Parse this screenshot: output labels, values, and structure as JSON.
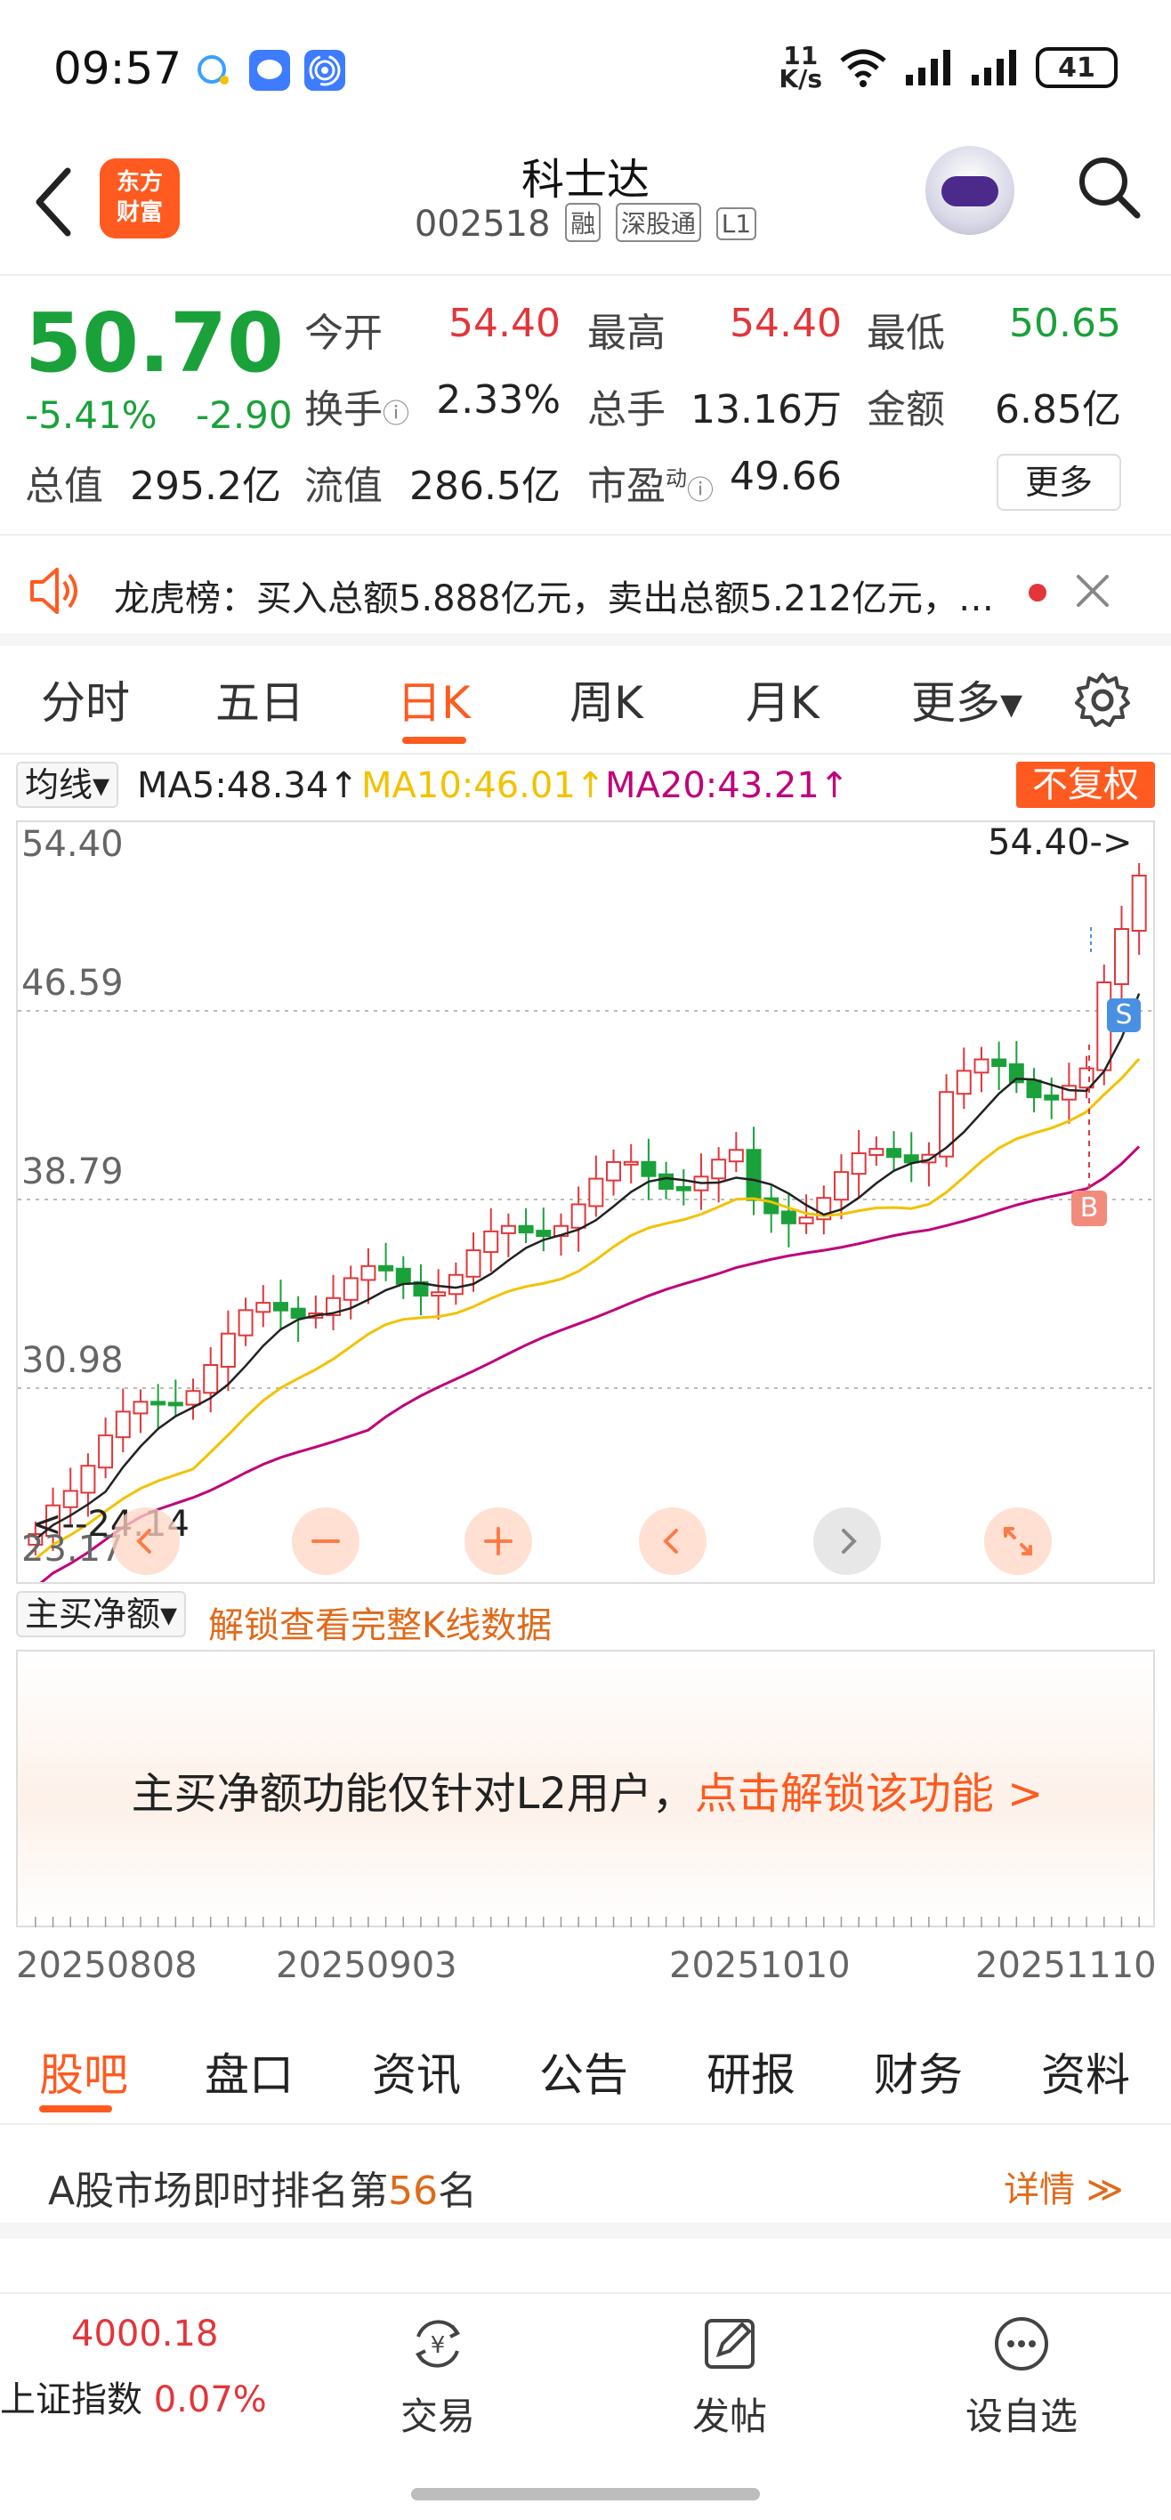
{
  "status_bar": {
    "time": "09:57",
    "network_speed_top": "11",
    "network_speed_unit": "K/s",
    "battery": "41"
  },
  "header": {
    "logo_line1": "东方",
    "logo_line2": "财富",
    "stock_name": "科士达",
    "stock_code": "002518",
    "tags": [
      "融",
      "深股通",
      "L1"
    ]
  },
  "quote": {
    "price": "50.70",
    "change_pct": "-5.41%",
    "change_amt": "-2.90",
    "open_label": "今开",
    "open": "54.40",
    "high_label": "最高",
    "high": "54.40",
    "low_label": "最低",
    "low": "50.65",
    "turnover_label": "换手",
    "turnover": "2.33%",
    "volume_label": "总手",
    "volume": "13.16万",
    "amount_label": "金额",
    "amount": "6.85亿",
    "mcap_label": "总值",
    "mcap": "295.2亿",
    "float_label": "流值",
    "float": "286.5亿",
    "pe_label": "市盈",
    "pe_sup": "动",
    "pe": "49.66",
    "more_label": "更多"
  },
  "banner": {
    "text": "龙虎榜：买入总额5.888亿元，卖出总额5.212亿元，…"
  },
  "period_tabs": [
    {
      "label": "分时"
    },
    {
      "label": "五日"
    },
    {
      "label": "日K"
    },
    {
      "label": "周K"
    },
    {
      "label": "月K"
    },
    {
      "label": "更多▾"
    }
  ],
  "ma": {
    "select_label": "均线▾",
    "ma5": "MA5:48.34↑",
    "ma10": "MA10:46.01↑",
    "ma20": "MA20:43.21↑",
    "fq_label": "不复权"
  },
  "kline": {
    "y_labels": [
      "54.40",
      "46.59",
      "38.79",
      "30.98",
      "23.17"
    ],
    "high_marker": "54.40->",
    "low_marker": "<--24.14",
    "s_marker": "S",
    "b_marker": "B",
    "colors": {
      "up": "#e2363a",
      "down": "#1aa13a",
      "ma5": "#222222",
      "ma10": "#f2c200",
      "ma20": "#c0007a"
    }
  },
  "main_buy": {
    "select_label": "主买净额▾",
    "unlock_link": "解锁查看完整K线数据",
    "panel_text": "主买净额功能仅针对L2用户，",
    "panel_link": "点击解锁该功能 >"
  },
  "date_axis": [
    "20250808",
    "20250903",
    "20251010",
    "20251110"
  ],
  "content_tabs": [
    {
      "label": "股吧"
    },
    {
      "label": "盘口"
    },
    {
      "label": "资讯"
    },
    {
      "label": "公告"
    },
    {
      "label": "研报"
    },
    {
      "label": "财务"
    },
    {
      "label": "资料"
    }
  ],
  "rank": {
    "prefix": "A股市场即时排名第",
    "number": "56",
    "suffix": "名",
    "detail": "详情 ≫"
  },
  "bottom_nav": {
    "index_value": "4000.18",
    "index_name": "上证指数",
    "index_change": "0.07%",
    "items": [
      {
        "label": "交易"
      },
      {
        "label": "发帖"
      },
      {
        "label": "设自选"
      }
    ]
  }
}
